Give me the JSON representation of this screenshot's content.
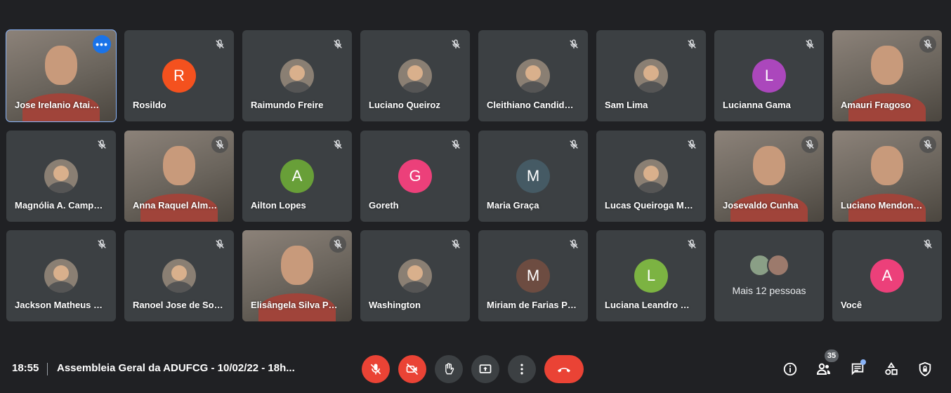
{
  "participants": [
    {
      "name": "Jose Irelanio Atai…",
      "type": "video",
      "selected": true,
      "options_label": "•••"
    },
    {
      "name": "Rosildo",
      "type": "initial",
      "initial": "R",
      "color": "#f4511e"
    },
    {
      "name": "Raimundo Freire",
      "type": "photo"
    },
    {
      "name": "Luciano Queiroz",
      "type": "photo"
    },
    {
      "name": "Cleithiano Candid…",
      "type": "photo"
    },
    {
      "name": "Sam Lima",
      "type": "photo"
    },
    {
      "name": "Lucianna Gama",
      "type": "initial",
      "initial": "L",
      "color": "#ab47bc"
    },
    {
      "name": "Amauri Fragoso",
      "type": "video"
    },
    {
      "name": "Magnólia A. Camp…",
      "type": "photo"
    },
    {
      "name": "Anna Raquel Alm…",
      "type": "video"
    },
    {
      "name": "Ailton Lopes",
      "type": "initial",
      "initial": "A",
      "color": "#689f38"
    },
    {
      "name": "Goreth",
      "type": "initial",
      "initial": "G",
      "color": "#ec407a"
    },
    {
      "name": "Maria Graça",
      "type": "initial",
      "initial": "M",
      "color": "#455a64"
    },
    {
      "name": "Lucas Queiroga M…",
      "type": "photo"
    },
    {
      "name": "Josevaldo Cunha",
      "type": "video"
    },
    {
      "name": "Luciano Mendon…",
      "type": "video"
    },
    {
      "name": "Jackson Matheus …",
      "type": "photo"
    },
    {
      "name": "Ranoel Jose de So…",
      "type": "photo"
    },
    {
      "name": "Elisângela Silva P…",
      "type": "video"
    },
    {
      "name": "Washington",
      "type": "photo"
    },
    {
      "name": "Miriam de Farias P…",
      "type": "initial",
      "initial": "M",
      "color": "#6d4c41"
    },
    {
      "name": "Luciana Leandro …",
      "type": "initial",
      "initial": "L",
      "color": "#7cb342"
    },
    {
      "name": "",
      "type": "more",
      "label": "Mais 12 pessoas"
    },
    {
      "name": "Você",
      "type": "initial",
      "initial": "A",
      "color": "#ec407a"
    }
  ],
  "bottom_bar": {
    "time": "18:55",
    "meeting_title": "Assembleia Geral da ADUFCG - 10/02/22 - 18h...",
    "participant_count": "35"
  },
  "colors": {
    "background": "#202124",
    "tile": "#3c4043",
    "danger": "#ea4335",
    "accent": "#8ab4f8"
  },
  "icons": {
    "controls": [
      "mic-off-icon",
      "camera-off-icon",
      "raise-hand-icon",
      "present-screen-icon",
      "more-options-icon",
      "end-call-icon"
    ],
    "right": [
      "info-icon",
      "people-icon",
      "chat-icon",
      "activities-icon",
      "host-controls-icon"
    ]
  }
}
